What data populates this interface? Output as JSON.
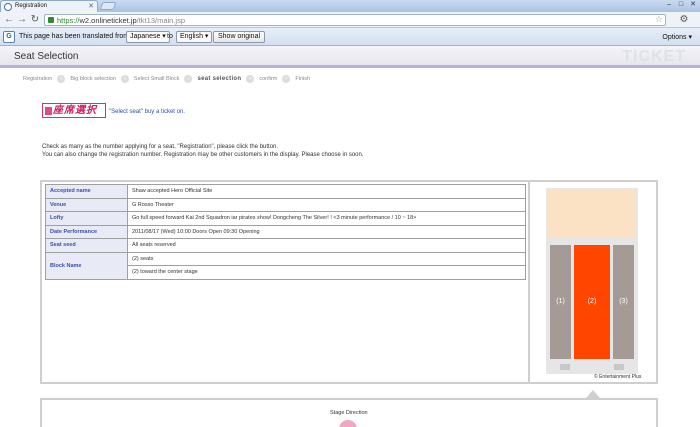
{
  "browser": {
    "tab_title": "Registration",
    "url_proto": "https://",
    "url_host": "w2.onlineticket.jp",
    "url_path": "/tkt13/main.jsp"
  },
  "translate": {
    "prefix": "This page has been translated from",
    "from_lang": "Japanese",
    "to_word": "to",
    "to_lang": "English",
    "show_original": "Show original",
    "options": "Options"
  },
  "page": {
    "title": "Seat Selection",
    "brand": "TICKET"
  },
  "steps": [
    {
      "label": "Registration",
      "active": false
    },
    {
      "label": "Big block selection",
      "active": false
    },
    {
      "label": "Select Small Block",
      "active": false
    },
    {
      "label": "seat selection",
      "active": true
    },
    {
      "label": "confirm",
      "active": false
    },
    {
      "label": "Finish",
      "active": false
    }
  ],
  "seat_badge": "座席選択",
  "instruction": "\"Select seat\" buy a ticket on.",
  "description_line1": "Check as many as the number applying for a seat, \"Registration\", please click the button.",
  "description_line2": "You can also change the registration number. Registration may be other customers in the display. Please choose in soon.",
  "info": {
    "accepted_name_label": "Accepted name",
    "accepted_name_value": "Shaw accepted Hero Official Site",
    "venue_label": "Venue",
    "venue_value": "G Rosso Theater",
    "lofty_label": "Lofty",
    "lofty_value": "Go full speed forward Kai 2nd Squadron iar pirates show! Dongcheng The Silver! ! <3 minute performance / 10 ~ 18>",
    "date_label": "Date Performance",
    "date_value": "2011/08/17 (Wed) 10:00 Doors Open 09:30 Opening",
    "seat_seed_label": "Seat seed",
    "seat_seed_value": "All seats reserved",
    "block_name_label": "Block Name",
    "block_name_value1": "(2) seats",
    "block_name_value2": "(2) toward the center stage"
  },
  "seatmap": {
    "blocks": [
      "(1)",
      "(2)",
      "(3)"
    ],
    "selected_color": "#ff4500",
    "unselected_color": "#a59b96",
    "stage_color": "#fbe2c4",
    "copyright": "© Entertainment Plus"
  },
  "stage_direction": "Stage Direction"
}
